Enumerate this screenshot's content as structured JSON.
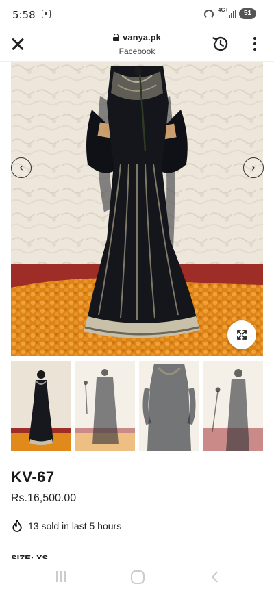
{
  "status_bar": {
    "time": "5:58",
    "network_label": "4G+",
    "battery": "51"
  },
  "browser": {
    "domain": "vanya.pk",
    "source": "Facebook"
  },
  "product": {
    "title": "KV-67",
    "price": "Rs.16,500.00",
    "sold_text": "13 sold in last 5 hours",
    "size_label": "SIZE: XS"
  },
  "gallery": {
    "prev_icon": "chevron-left-icon",
    "next_icon": "chevron-right-icon",
    "expand_icon": "expand-icon",
    "thumbnail_count": 4
  },
  "colors": {
    "dress": "#14161c",
    "wall": "#ece4d8",
    "marigold": "#e08a1c",
    "floor": "#a8302a"
  }
}
